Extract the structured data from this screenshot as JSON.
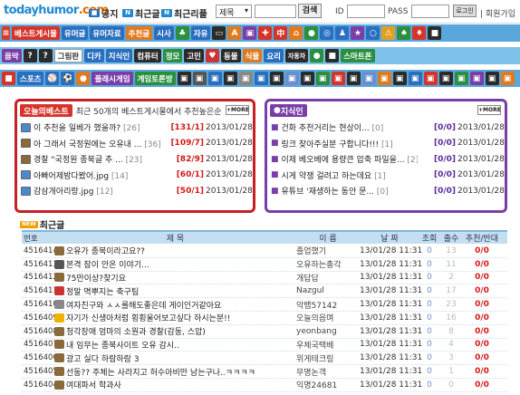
{
  "logo": {
    "main": "todayhumor",
    "dot": ".com"
  },
  "header": {
    "notice": "공지",
    "latest_best": "최근글",
    "latest_recent": "최근리플",
    "search_field": "제목",
    "search_button": "검색",
    "id_label": "ID",
    "pass_label": "PASS",
    "login_button": "로그인",
    "join": "회원가입"
  },
  "menu_row1": [
    "베스트게시물",
    "유머글",
    "유머자료",
    "추천글",
    "시사",
    "",
    "자유",
    "",
    "",
    "",
    "",
    ""
  ],
  "menu_row2": [
    "음악",
    "",
    "그림판",
    "디카",
    "지식인",
    "컴퓨터",
    "정모",
    "고민",
    "",
    "동물",
    "식물",
    "요리",
    "자동차",
    "",
    "",
    "스마트폰"
  ],
  "menu_row3": [
    "",
    "스포츠",
    "",
    "",
    "",
    "플래시게임",
    "게임토론방"
  ],
  "best_box": {
    "tag": "오늘의베스트",
    "subtitle": "최근 50개의 베스트게시물에서 추천높은순",
    "more": "+MORE",
    "items": [
      {
        "title": "이 추천을 일베가 했을까? ",
        "count": "[26]",
        "rc": "[131/1]",
        "date": "2013/01/28"
      },
      {
        "title": "아 그래서 국정원에는 오유내 ...",
        "count": "[36]",
        "rc": "[109/7]",
        "date": "2013/01/28"
      },
      {
        "title": "경찰 \"국정원 종북글 추 ...",
        "count": "[23]",
        "rc": "[82/9]",
        "date": "2013/01/28"
      },
      {
        "title": "아빠어제밤다봤어.jpg",
        "count": "[14]",
        "rc": "[60/1]",
        "date": "2013/01/28"
      },
      {
        "title": "감삼개아리랑.jpg",
        "count": "[12]",
        "rc": "[50/1]",
        "date": "2013/01/28"
      }
    ]
  },
  "jisik_box": {
    "tag": "지식인",
    "more": "+MORE",
    "items": [
      {
        "title": "건화 추천거리는 현상이...",
        "count": "[0]",
        "rc": "[0/0]",
        "date": "2013/01/28"
      },
      {
        "title": "링크 찾아주실분 구합니다!!!",
        "count": "[1]",
        "rc": "[0/0]",
        "date": "2013/01/28"
      },
      {
        "title": "이제 베오베에 용량큰 압축 파일을...",
        "count": "[2]",
        "rc": "[0/0]",
        "date": "2013/01/28"
      },
      {
        "title": "시게 약쟁 걸려고 하는데요",
        "count": "[1]",
        "rc": "[0/0]",
        "date": "2013/01/28"
      },
      {
        "title": "유튜브 '재생하는 동안 문...",
        "count": "[0]",
        "rc": "[0/0]",
        "date": "2013/01/28"
      }
    ]
  },
  "recent": {
    "section_title": "최근글",
    "headers": {
      "no": "번호",
      "title": "제 목",
      "name": "이 름",
      "date": "날 짜",
      "view": "조회",
      "ok": "출수",
      "rec": "추천/반대"
    },
    "rows": [
      {
        "no": "4516414",
        "title": "오유가 종북이라고요??",
        "name": "졸업했기",
        "date": "13/01/28 11:31",
        "v": "0",
        "ok": "13",
        "r": "0/0",
        "ic": "#8a6a3a"
      },
      {
        "no": "4516413",
        "title": "본격 잠이 안온 이야기...",
        "name": "오유하는총각",
        "date": "13/01/28 11:31",
        "v": "0",
        "ok": "11",
        "r": "0/0",
        "ic": "#555"
      },
      {
        "no": "4516412",
        "title": "75만이상?찾기요",
        "name": "개답답",
        "date": "13/01/28 11:31",
        "v": "0",
        "ok": "2",
        "r": "0/0",
        "ic": "#8a6a3a"
      },
      {
        "no": "4516411",
        "title": "정말 멱뿌지는 축구팀",
        "name": "Nazgul",
        "date": "13/01/28 11:31",
        "v": "0",
        "ok": "17",
        "r": "0/0",
        "ic": "#c33"
      },
      {
        "no": "4516410",
        "title": "여자친구와 ㅅㅅ를해도좋은데 게이인거같아요",
        "name": "악뱀57142",
        "date": "13/01/28 11:31",
        "v": "0",
        "ok": "23",
        "r": "0/0",
        "ic": "#888"
      },
      {
        "no": "4516409",
        "title": "자기가 신생아처럼 횡횡울어보고싶다 하시는분!!",
        "name": "오늘의음며",
        "date": "13/01/28 11:31",
        "v": "0",
        "ok": "16",
        "r": "0/0",
        "ic": "#f0b400"
      },
      {
        "no": "4516408",
        "title": "청각장애 엄마의 소원과 경찰(감동, 스압)",
        "name": "yeonbang",
        "date": "13/01/28 11:31",
        "v": "0",
        "ok": "8",
        "r": "0/0",
        "ic": "#8a6a3a"
      },
      {
        "no": "4516407",
        "title": "내 임무는 종북사이트 오유 감시..",
        "name": "우체국택배",
        "date": "13/01/28 11:31",
        "v": "0",
        "ok": "4",
        "r": "0/0",
        "ic": "#8a6a3a"
      },
      {
        "no": "4516406",
        "title": "광고 실다 하람하람 3",
        "name": "위게테크링",
        "date": "13/01/28 11:31",
        "v": "0",
        "ok": "3",
        "r": "0/0",
        "ic": "#8a6a3a"
      },
      {
        "no": "4516405",
        "title": "선동?? 주체는 사라지고 허수아비만 남는구나..ㅋㅋㅋㅋ",
        "name": "무명논객",
        "date": "13/01/28 11:31",
        "v": "0",
        "ok": "1",
        "r": "0/0",
        "ic": "#8a6a3a"
      },
      {
        "no": "4516404",
        "title": "여대파서 학과사",
        "name": "익명24681",
        "date": "13/01/28 11:31",
        "v": "0",
        "ok": "0",
        "r": "0/0",
        "ic": "#8a6a3a"
      }
    ]
  }
}
